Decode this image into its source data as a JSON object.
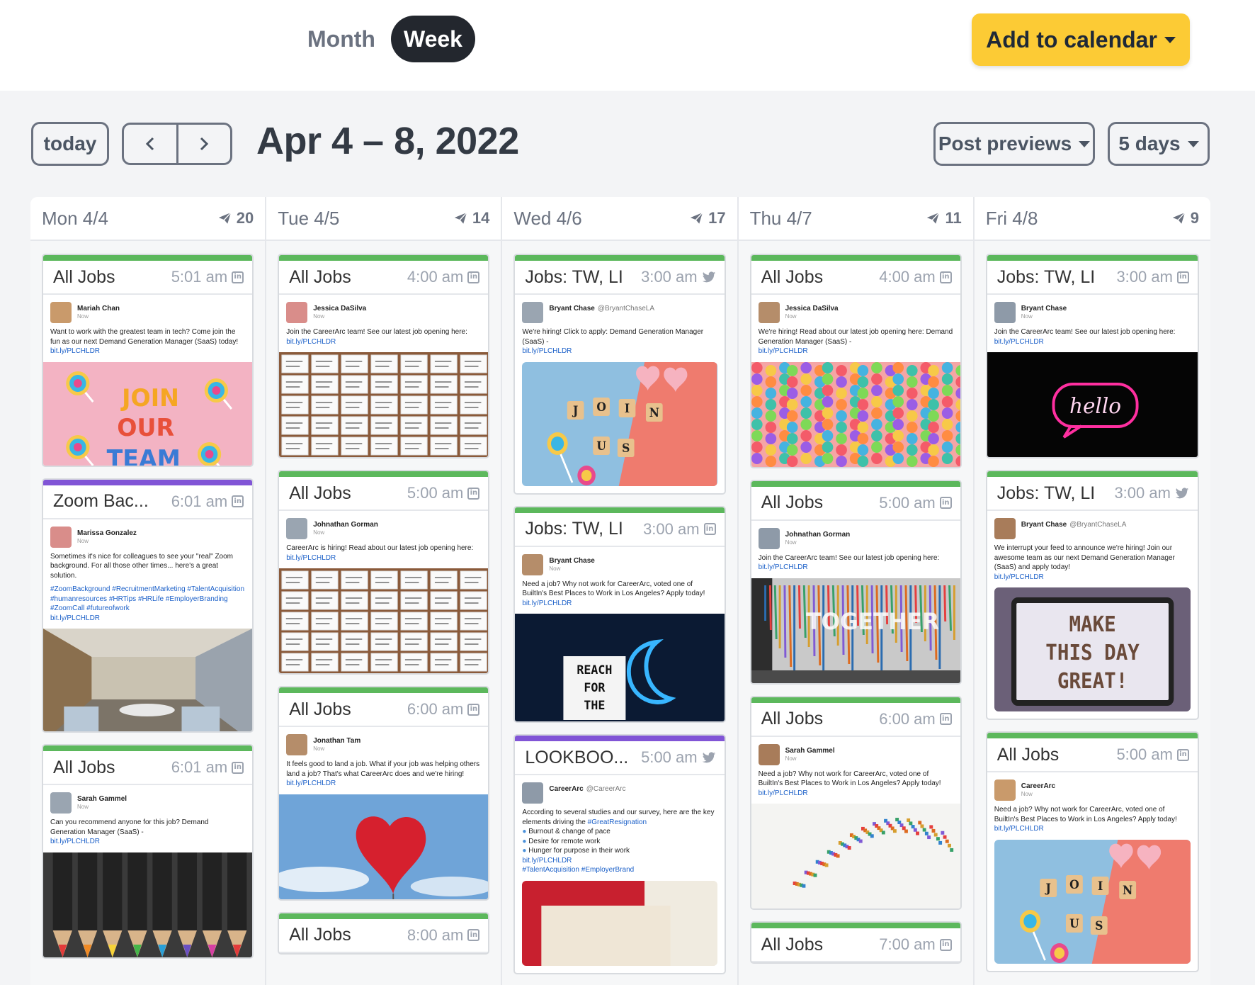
{
  "header": {
    "view_month": "Month",
    "view_week": "Week",
    "add_to_calendar": "Add to calendar"
  },
  "toolbar": {
    "today": "today",
    "prev": "‹",
    "next": "›",
    "range_title": "Apr 4 – 8, 2022",
    "post_previews": "Post previews",
    "days": "5 days"
  },
  "colors": {
    "accent_yellow": "#fccb35",
    "green_bar": "#5cb85c",
    "purple_bar": "#8155d6",
    "link_blue": "#1a5fc8"
  },
  "days": [
    {
      "name": "Mon 4/4",
      "count": "20",
      "posts": [
        {
          "title": "All Jobs",
          "time": "5:01 am",
          "network": "linkedin-icon",
          "author": "Mariah Chan",
          "handle": "",
          "sub": "Now",
          "text": "Want to work with the greatest team in tech? Come join the fun as our next Demand Generation Manager (SaaS) today!",
          "link": "bit.ly/PLCHLDR",
          "image": "join-our-team-lollipops"
        },
        {
          "title": "Zoom Bac...",
          "time": "6:01 am",
          "network": "linkedin-icon",
          "author": "Marissa Gonzalez",
          "handle": "",
          "sub": "Now",
          "text": "Sometimes it's nice for colleagues to see your \"real\" Zoom background. For all those other times... here's a great solution.",
          "tags": "#ZoomBackground #RecruitmentMarketing #TalentAcquisition #humanresources #HRTips #HRLife #EmployerBranding #ZoomCall #futureofwork",
          "link": "bit.ly/PLCHLDR",
          "image": "office-lobby"
        },
        {
          "title": "All Jobs",
          "time": "6:01 am",
          "network": "linkedin-icon",
          "author": "Sarah Gammel",
          "handle": "",
          "sub": "Now",
          "text": "Can you recommend anyone for this job? Demand Generation Manager (SaaS) -",
          "link": "bit.ly/PLCHLDR",
          "image": "colored-pencils"
        }
      ]
    },
    {
      "name": "Tue 4/5",
      "count": "14",
      "posts": [
        {
          "title": "All Jobs",
          "time": "4:00 am",
          "network": "linkedin-icon",
          "author": "Jessica DaSilva",
          "handle": "",
          "sub": "Now",
          "text": "Join the CareerArc team! See our latest job opening here:",
          "link": "bit.ly/PLCHLDR",
          "image": "sticky-notes-board"
        },
        {
          "title": "All Jobs",
          "time": "5:00 am",
          "network": "linkedin-icon",
          "author": "Johnathan Gorman",
          "handle": "",
          "sub": "Now",
          "text": "CareerArc is hiring! Read about our latest job opening here:",
          "link": "bit.ly/PLCHLDR",
          "image": "sticky-notes-board"
        },
        {
          "title": "All Jobs",
          "time": "6:00 am",
          "network": "linkedin-icon",
          "author": "Jonathan Tam",
          "handle": "",
          "sub": "Now",
          "text": "It feels good to land a job. What if your job was helping others land a job? That's what CareerArc does and we're hiring!",
          "link": "bit.ly/PLCHLDR",
          "image": "red-heart-balloon-sky"
        },
        {
          "title": "All Jobs",
          "time": "8:00 am",
          "network": "linkedin-icon",
          "author": "",
          "handle": "",
          "sub": "",
          "text": "",
          "link": "",
          "image": ""
        }
      ]
    },
    {
      "name": "Wed 4/6",
      "count": "17",
      "posts": [
        {
          "title": "Jobs: TW, LI",
          "time": "3:00 am",
          "network": "twitter-icon",
          "author": "Bryant Chase",
          "handle": "@BryantChaseLA",
          "sub": "",
          "text": "We're hiring! Click to apply: Demand Generation Manager (SaaS) -",
          "link": "bit.ly/PLCHLDR",
          "image": "join-us-tiles"
        },
        {
          "title": "Jobs: TW, LI",
          "time": "3:00 am",
          "network": "linkedin-icon",
          "author": "Bryant Chase",
          "handle": "",
          "sub": "Now",
          "text": "Need a job? Why not work for CareerArc, voted one of BuiltIn's Best Places to Work in Los Angeles? Apply today!",
          "link": "bit.ly/PLCHLDR",
          "image": "reach-for-the-moon"
        },
        {
          "title": "LOOKBOO...",
          "time": "5:00 am",
          "network": "twitter-icon",
          "author": "CareerArc",
          "handle": "@CareerArc",
          "sub": "",
          "text": "According to several studies and our survey, here are the key elements driving the",
          "hashtag": "#GreatResignation",
          "bullets": [
            "Burnout & change of pace",
            "Desire for remote work",
            "Hunger for purpose in their work"
          ],
          "link": "bit.ly/PLCHLDR",
          "tags": "#TalentAcquisition #EmployerBrand",
          "image": "lookbook-cover"
        }
      ]
    },
    {
      "name": "Thu 4/7",
      "count": "11",
      "posts": [
        {
          "title": "All Jobs",
          "time": "4:00 am",
          "network": "linkedin-icon",
          "author": "Jessica DaSilva",
          "handle": "",
          "sub": "Now",
          "text": "We're hiring! Read about our latest job opening here: Demand Generation Manager (SaaS) -",
          "link": "bit.ly/PLCHLDR",
          "image": "confetti"
        },
        {
          "title": "All Jobs",
          "time": "5:00 am",
          "network": "linkedin-icon",
          "author": "Johnathan Gorman",
          "handle": "",
          "sub": "Now",
          "text": "Join the CareerArc team! See our latest job opening here:",
          "link": "bit.ly/PLCHLDR",
          "image": "together-paint-wall"
        },
        {
          "title": "All Jobs",
          "time": "6:00 am",
          "network": "linkedin-icon",
          "author": "Sarah Gammel",
          "handle": "",
          "sub": "Now",
          "text": "Need a job? Why not work for CareerArc, voted one of BuiltIn's Best Places to Work in Los Angeles? Apply today!",
          "link": "bit.ly/PLCHLDR",
          "image": "rainbow-confetti-trail"
        },
        {
          "title": "All Jobs",
          "time": "7:00 am",
          "network": "linkedin-icon",
          "author": "",
          "handle": "",
          "sub": "",
          "text": "",
          "link": "",
          "image": ""
        }
      ]
    },
    {
      "name": "Fri 4/8",
      "count": "9",
      "posts": [
        {
          "title": "Jobs: TW, LI",
          "time": "3:00 am",
          "network": "linkedin-icon",
          "author": "Bryant Chase",
          "handle": "",
          "sub": "Now",
          "text": "Join the CareerArc team! See our latest job opening here:",
          "link": "bit.ly/PLCHLDR",
          "image": "hello-neon"
        },
        {
          "title": "Jobs: TW, LI",
          "time": "3:00 am",
          "network": "twitter-icon",
          "author": "Bryant Chase",
          "handle": "@BryantChaseLA",
          "sub": "",
          "text": "We interrupt your feed to announce we're hiring! Join our awesome team as our next Demand Generation Manager (SaaS) and apply today!",
          "link": "bit.ly/PLCHLDR",
          "image": "make-this-day-great"
        },
        {
          "title": "All Jobs",
          "time": "5:00 am",
          "network": "linkedin-icon",
          "author": "CareerArc",
          "handle": "",
          "sub": "Now",
          "text": "Need a job? Why not work for CareerArc, voted one of BuiltIn's Best Places to Work in Los Angeles? Apply today!",
          "link": "bit.ly/PLCHLDR",
          "image": "join-us-tiles"
        }
      ]
    }
  ],
  "image_texts": {
    "join_our_team": [
      "JOIN",
      "OUR",
      "TEAM"
    ],
    "join_us": [
      "J",
      "O",
      "I",
      "N",
      "U",
      "S"
    ],
    "reach": [
      "REACH",
      "FOR",
      "THE"
    ],
    "together": "TOGETHER",
    "hello": "hello",
    "make_day": [
      "MAKE",
      "THIS DAY",
      "GREAT!"
    ]
  }
}
